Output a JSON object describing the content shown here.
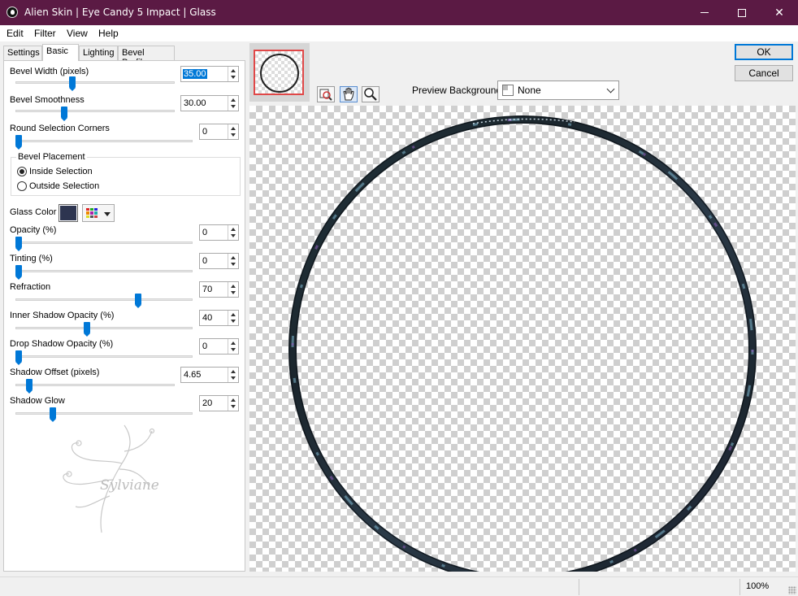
{
  "window": {
    "title": "Alien Skin | Eye Candy 5 Impact | Glass",
    "accent_color": "#5b1a44"
  },
  "menu": {
    "items": [
      "Edit",
      "Filter",
      "View",
      "Help"
    ]
  },
  "tabs": [
    "Settings",
    "Basic",
    "Lighting",
    "Bevel Profile"
  ],
  "active_tab": "Basic",
  "controls": {
    "bevel_width": {
      "label": "Bevel Width (pixels)",
      "value": "35.00",
      "level": 0.35
    },
    "bevel_smoothness": {
      "label": "Bevel Smoothness",
      "value": "30.00",
      "level": 0.3
    },
    "round_corners": {
      "label": "Round Selection Corners",
      "value": "0",
      "level": 0.0
    },
    "bevel_placement": {
      "label": "Bevel Placement",
      "options": [
        "Inside Selection",
        "Outside Selection"
      ],
      "selected": "Inside Selection"
    },
    "glass_color": {
      "label": "Glass Color",
      "color": "#2d3550"
    },
    "opacity": {
      "label": "Opacity (%)",
      "value": "0",
      "level": 0.0
    },
    "tinting": {
      "label": "Tinting (%)",
      "value": "0",
      "level": 0.0
    },
    "refraction": {
      "label": "Refraction",
      "value": "70",
      "level": 0.7
    },
    "inner_shadow_opacity": {
      "label": "Inner Shadow Opacity (%)",
      "value": "40",
      "level": 0.4
    },
    "drop_shadow_opacity": {
      "label": "Drop Shadow Opacity (%)",
      "value": "0",
      "level": 0.0
    },
    "shadow_offset": {
      "label": "Shadow Offset (pixels)",
      "value": "4.65",
      "level": 0.07
    },
    "shadow_glow": {
      "label": "Shadow Glow",
      "value": "20",
      "level": 0.2
    }
  },
  "watermark": {
    "text": "Sylviane"
  },
  "preview_background": {
    "label": "Preview Background:",
    "value": "None"
  },
  "buttons": {
    "ok": "OK",
    "cancel": "Cancel"
  },
  "tools": [
    "navigator-icon",
    "hand-icon",
    "zoom-icon"
  ],
  "status": {
    "zoom": "100%"
  }
}
